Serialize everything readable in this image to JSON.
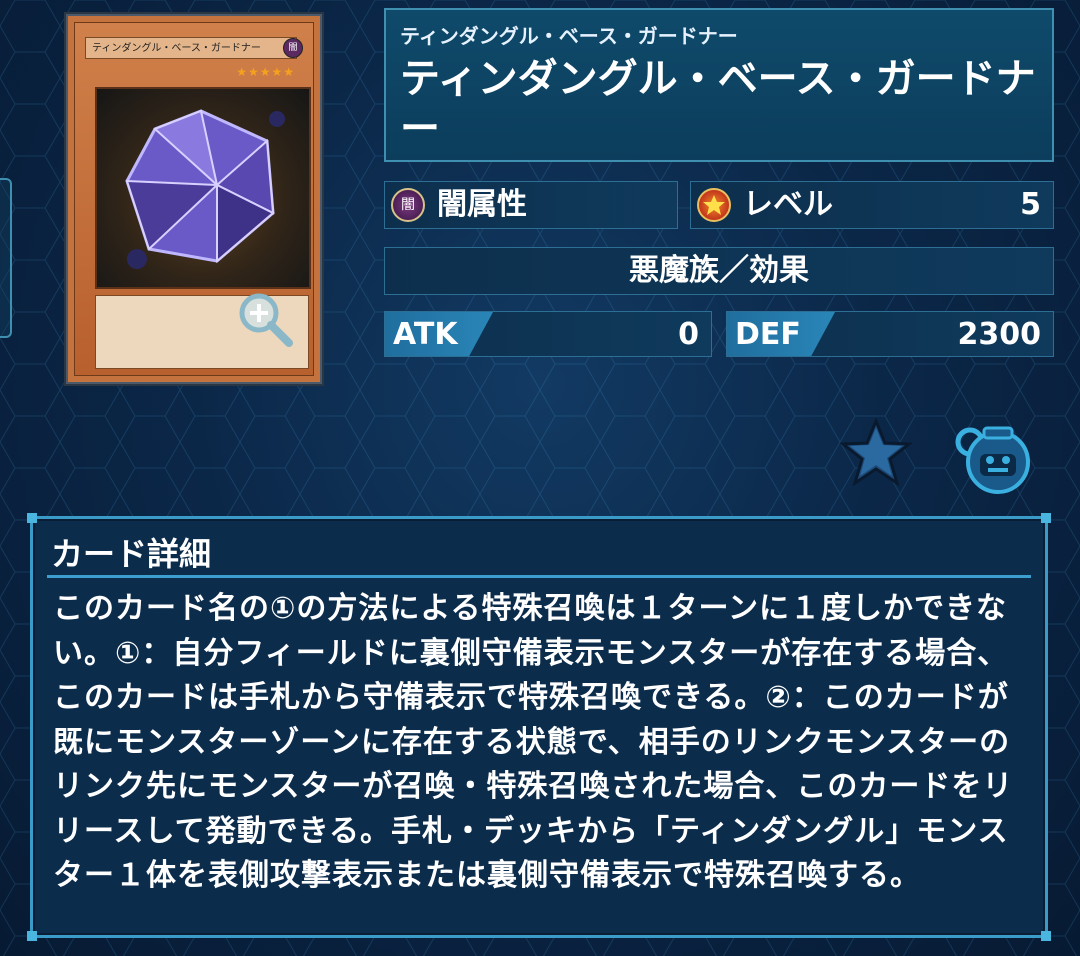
{
  "card": {
    "name_on_card": "ティンダングル・ベース・ガードナー",
    "attribute_mini": "闇",
    "stars": "★★★★★"
  },
  "header": {
    "ruby": "ティンダングル・ベース・ガードナー",
    "name": "ティンダングル・ベース・ガードナー"
  },
  "stats": {
    "attribute_icon_text": "闇",
    "attribute": "闇属性",
    "level_label": "レベル",
    "level_value": "5",
    "type": "悪魔族／効果",
    "atk_label": "ATK",
    "atk_value": "0",
    "def_label": "DEF",
    "def_value": "2300"
  },
  "icons": {
    "favorite": "star-icon",
    "mascot": "mascot-icon",
    "zoom": "zoom-in-icon"
  },
  "detail": {
    "title": "カード詳細",
    "text": "このカード名の①の方法による特殊召喚は１ターンに１度しかできない。①：自分フィールドに裏側守備表示モンスターが存在する場合、このカードは手札から守備表示で特殊召喚できる。②：このカードが既にモンスターゾーンに存在する状態で、相手のリンクモンスターのリンク先にモンスターが召喚・特殊召喚された場合、このカードをリリースして発動できる。手札・デッキから「ティンダングル」モンスター１体を表側攻撃表示または裏側守備表示で特殊召喚する。"
  },
  "colors": {
    "panel_border": "#3e8fb0",
    "accent": "#2a86b8",
    "background": "#0b2748"
  }
}
